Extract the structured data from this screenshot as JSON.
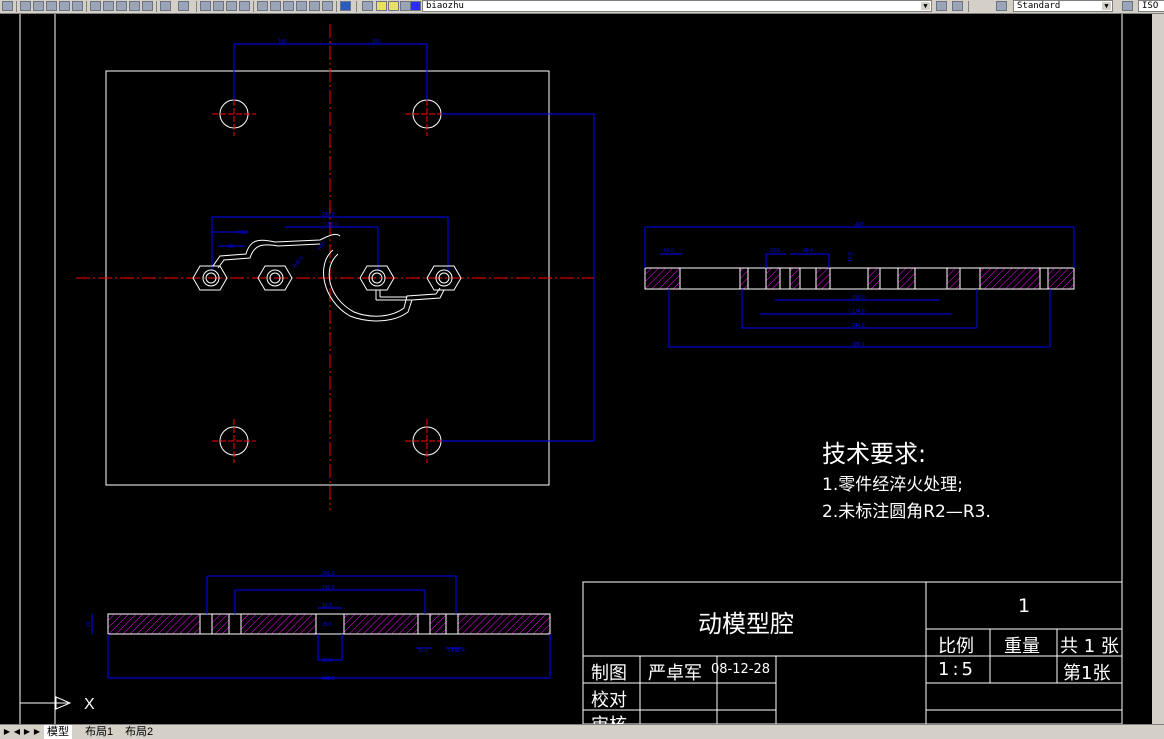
{
  "toolbar": {
    "layer_name": "biaozhu",
    "text_style": "Standard",
    "dim_style_partial": "ISO"
  },
  "drawing": {
    "top_view": {
      "dims": [
        "150",
        "150",
        "243.0",
        "150.0",
        "R12",
        "26",
        "R40.5",
        "R50"
      ]
    },
    "side_view": {
      "dims": [
        "420",
        "56.0",
        "23.6",
        "40.4",
        "16.2",
        "150.0",
        "174.0",
        "244.0",
        "386.1"
      ]
    },
    "bottom_view": {
      "dims": [
        "250.0",
        "150.0",
        "16.8",
        "25.6",
        "35.0",
        "15.0",
        "14.0",
        "16.4",
        "408.0",
        "22"
      ]
    },
    "tech_req": {
      "title": "技术要求:",
      "items": [
        "1.零件经淬火处理;",
        "2.未标注圆角R2—R3."
      ]
    },
    "title_block": {
      "part_name": "动模型腔",
      "number": "1",
      "scale_label": "比例",
      "weight_label": "重量",
      "total_sheets": "共 1 张",
      "scale_value": "1:5",
      "sheet_index": "第1张",
      "drawn_label": "制图",
      "drawn_by": "严卓军",
      "drawn_date": "08-12-28",
      "checked_label": "校对",
      "review_label": "审核"
    },
    "ucs_label": "X"
  },
  "status": {
    "tabs": [
      "模型",
      "布局1",
      "布局2"
    ]
  },
  "colors": {
    "background": "#000000",
    "geometry": "#ffffff",
    "dimension": "#0000ff",
    "centerline": "#ff0000",
    "hatch": "#ff00ff"
  }
}
